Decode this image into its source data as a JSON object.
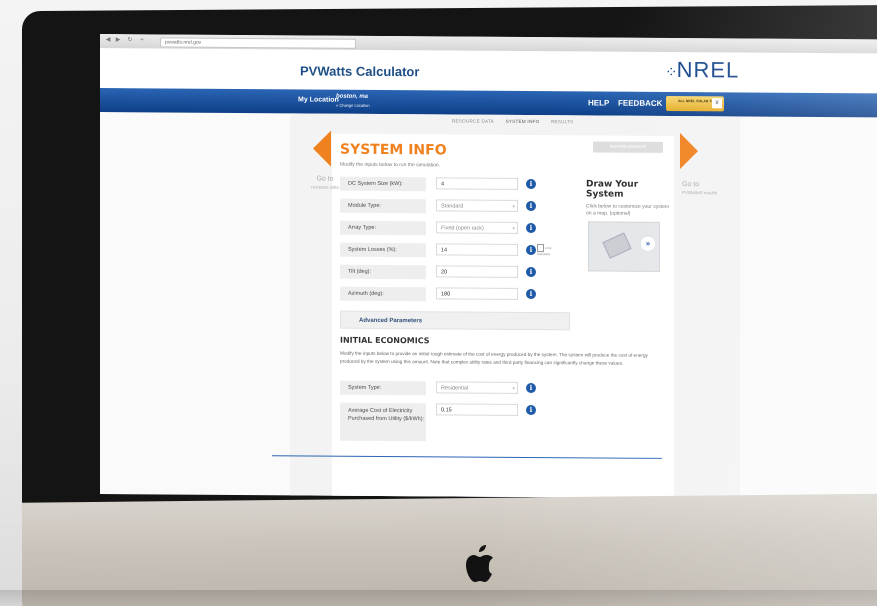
{
  "browser": {
    "url": "pvwatts.nrel.gov"
  },
  "header": {
    "app_title": "PVWatts Calculator",
    "brand": "NREL"
  },
  "nav": {
    "my_location_label": "My Location",
    "location_name": "boston, ma",
    "change_location": "» Change Location",
    "help": "HELP",
    "feedback": "FEEDBACK",
    "all_tools": "ALL NREL SOLAR TOOLS",
    "tools_arrow": "¥"
  },
  "steps": [
    "RESOURCE DATA",
    "SYSTEM INFO",
    "RESULTS"
  ],
  "left_nav": {
    "label": "Go to",
    "sub": "resource data"
  },
  "right_nav": {
    "label": "Go to",
    "sub": "PVWatts® results"
  },
  "system_info": {
    "title": "SYSTEM INFO",
    "subtitle": "Modify the inputs below to run the simulation.",
    "restore_button": "RESTORE DEFAULTS",
    "fields": [
      {
        "label": "DC System Size (kW):",
        "value": "4"
      },
      {
        "label": "Module Type:",
        "value": "Standard"
      },
      {
        "label": "Array Type:",
        "value": "Fixed (open rack)"
      },
      {
        "label": "System Losses (%):",
        "value": "14"
      },
      {
        "label": "Tilt (deg):",
        "value": "20"
      },
      {
        "label": "Azimuth (deg):",
        "value": "180"
      }
    ],
    "loss_calculator": "Loss Calculator",
    "advanced": "Advanced Parameters"
  },
  "draw_system": {
    "title": "Draw Your System",
    "text": "Click below to customize your system on a map. (optional)"
  },
  "economics": {
    "title": "INITIAL ECONOMICS",
    "text": "Modify the inputs below to provide an initial rough estimate of the cost of energy produced by the system. The system will produce the cost of energy produced by the system using this amount. Note that complex utility rates and third party financing can significantly change these values.",
    "fields": [
      {
        "label": "System Type:",
        "value": "Residential"
      },
      {
        "label": "Average Cost of Electricity Purchased from Utility ($/kWh):",
        "value": "0.15"
      }
    ]
  },
  "colors": {
    "accent_orange": "#f0811f",
    "nav_blue": "#1e5aa8",
    "brand_blue": "#16478c"
  }
}
